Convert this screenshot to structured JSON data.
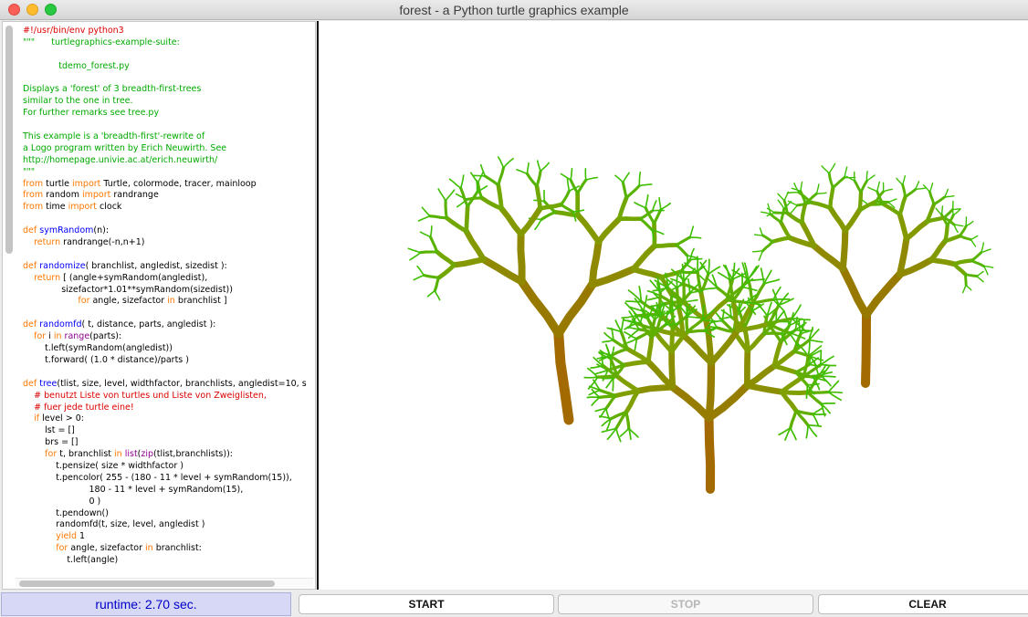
{
  "window": {
    "title": "forest - a Python turtle graphics example"
  },
  "code_lines": [
    [
      [
        "c-com",
        "#!/usr/bin/env python3"
      ]
    ],
    [
      [
        "c-str",
        "\"\"\"      turtlegraphics-example-suite:"
      ]
    ],
    [
      [
        "",
        ""
      ]
    ],
    [
      [
        "c-str",
        "             tdemo_forest.py"
      ]
    ],
    [
      [
        "",
        ""
      ]
    ],
    [
      [
        "c-str",
        "Displays a 'forest' of 3 breadth-first-trees"
      ]
    ],
    [
      [
        "c-str",
        "similar to the one in tree."
      ]
    ],
    [
      [
        "c-str",
        "For further remarks see tree.py"
      ]
    ],
    [
      [
        "",
        ""
      ]
    ],
    [
      [
        "c-str",
        "This example is a 'breadth-first'-rewrite of"
      ]
    ],
    [
      [
        "c-str",
        "a Logo program written by Erich Neuwirth. See"
      ]
    ],
    [
      [
        "c-str",
        "http://homepage.univie.ac.at/erich.neuwirth/"
      ]
    ],
    [
      [
        "c-str",
        "\"\"\""
      ]
    ],
    [
      [
        "c-kw",
        "from"
      ],
      [
        "",
        " turtle "
      ],
      [
        "c-kw",
        "import"
      ],
      [
        "",
        " Turtle, colormode, tracer, mainloop"
      ]
    ],
    [
      [
        "c-kw",
        "from"
      ],
      [
        "",
        " random "
      ],
      [
        "c-kw",
        "import"
      ],
      [
        "",
        " randrange"
      ]
    ],
    [
      [
        "c-kw",
        "from"
      ],
      [
        "",
        " time "
      ],
      [
        "c-kw",
        "import"
      ],
      [
        "",
        " clock"
      ]
    ],
    [
      [
        "",
        ""
      ]
    ],
    [
      [
        "c-kw",
        "def "
      ],
      [
        "c-def",
        "symRandom"
      ],
      [
        "",
        "(n):"
      ]
    ],
    [
      [
        "",
        "    "
      ],
      [
        "c-kw",
        "return"
      ],
      [
        "",
        " randrange(-n,n+1)"
      ]
    ],
    [
      [
        "",
        ""
      ]
    ],
    [
      [
        "c-kw",
        "def "
      ],
      [
        "c-def",
        "randomize"
      ],
      [
        "",
        "( branchlist, angledist, sizedist ):"
      ]
    ],
    [
      [
        "",
        "    "
      ],
      [
        "c-kw",
        "return"
      ],
      [
        "",
        " [ (angle+symRandom(angledist),"
      ]
    ],
    [
      [
        "",
        "              sizefactor*1.01**symRandom(sizedist))"
      ]
    ],
    [
      [
        "",
        "                    "
      ],
      [
        "c-kw",
        "for"
      ],
      [
        "",
        " angle, sizefactor "
      ],
      [
        "c-kw",
        "in"
      ],
      [
        "",
        " branchlist ]"
      ]
    ],
    [
      [
        "",
        ""
      ]
    ],
    [
      [
        "c-kw",
        "def "
      ],
      [
        "c-def",
        "randomfd"
      ],
      [
        "",
        "( t, distance, parts, angledist ):"
      ]
    ],
    [
      [
        "",
        "    "
      ],
      [
        "c-kw",
        "for"
      ],
      [
        "",
        " i "
      ],
      [
        "c-kw",
        "in"
      ],
      [
        "",
        " "
      ],
      [
        "c-bi",
        "range"
      ],
      [
        "",
        "(parts):"
      ]
    ],
    [
      [
        "",
        "        t.left(symRandom(angledist))"
      ]
    ],
    [
      [
        "",
        "        t.forward( (1.0 * distance)/parts )"
      ]
    ],
    [
      [
        "",
        ""
      ]
    ],
    [
      [
        "c-kw",
        "def "
      ],
      [
        "c-def",
        "tree"
      ],
      [
        "",
        "(tlist, size, level, widthfactor, branchlists, angledist=10, s"
      ]
    ],
    [
      [
        "",
        "    "
      ],
      [
        "c-com",
        "# benutzt Liste von turtles und Liste von Zweiglisten,"
      ]
    ],
    [
      [
        "",
        "    "
      ],
      [
        "c-com",
        "# fuer jede turtle eine!"
      ]
    ],
    [
      [
        "",
        "    "
      ],
      [
        "c-kw",
        "if"
      ],
      [
        "",
        " level > 0:"
      ]
    ],
    [
      [
        "",
        "        lst = []"
      ]
    ],
    [
      [
        "",
        "        brs = []"
      ]
    ],
    [
      [
        "",
        "        "
      ],
      [
        "c-kw",
        "for"
      ],
      [
        "",
        " t, branchlist "
      ],
      [
        "c-kw",
        "in"
      ],
      [
        "",
        " "
      ],
      [
        "c-bi",
        "list"
      ],
      [
        "",
        "("
      ],
      [
        "c-bi",
        "zip"
      ],
      [
        "",
        "(tlist,branchlists)):"
      ]
    ],
    [
      [
        "",
        "            t.pensize( size * widthfactor )"
      ]
    ],
    [
      [
        "",
        "            t.pencolor( 255 - (180 - 11 * level + symRandom(15)),"
      ]
    ],
    [
      [
        "",
        "                        180 - 11 * level + symRandom(15),"
      ]
    ],
    [
      [
        "",
        "                        0 )"
      ]
    ],
    [
      [
        "",
        "            t.pendown()"
      ]
    ],
    [
      [
        "",
        "            randomfd(t, size, level, angledist )"
      ]
    ],
    [
      [
        "",
        "            "
      ],
      [
        "c-kw",
        "yield"
      ],
      [
        "",
        " 1"
      ]
    ],
    [
      [
        "",
        "            "
      ],
      [
        "c-kw",
        "for"
      ],
      [
        "",
        " angle, sizefactor "
      ],
      [
        "c-kw",
        "in"
      ],
      [
        "",
        " branchlist:"
      ]
    ],
    [
      [
        "",
        "                t.left(angle)"
      ]
    ]
  ],
  "controls": {
    "runtime": "runtime: 2.70 sec.",
    "start": "START",
    "stop": "STOP",
    "clear": "CLEAR"
  },
  "trees": {
    "colors": {
      "trunk": "#a26a00",
      "mid": "#7fa000",
      "leaf": "#22cc00"
    },
    "count": 3
  }
}
